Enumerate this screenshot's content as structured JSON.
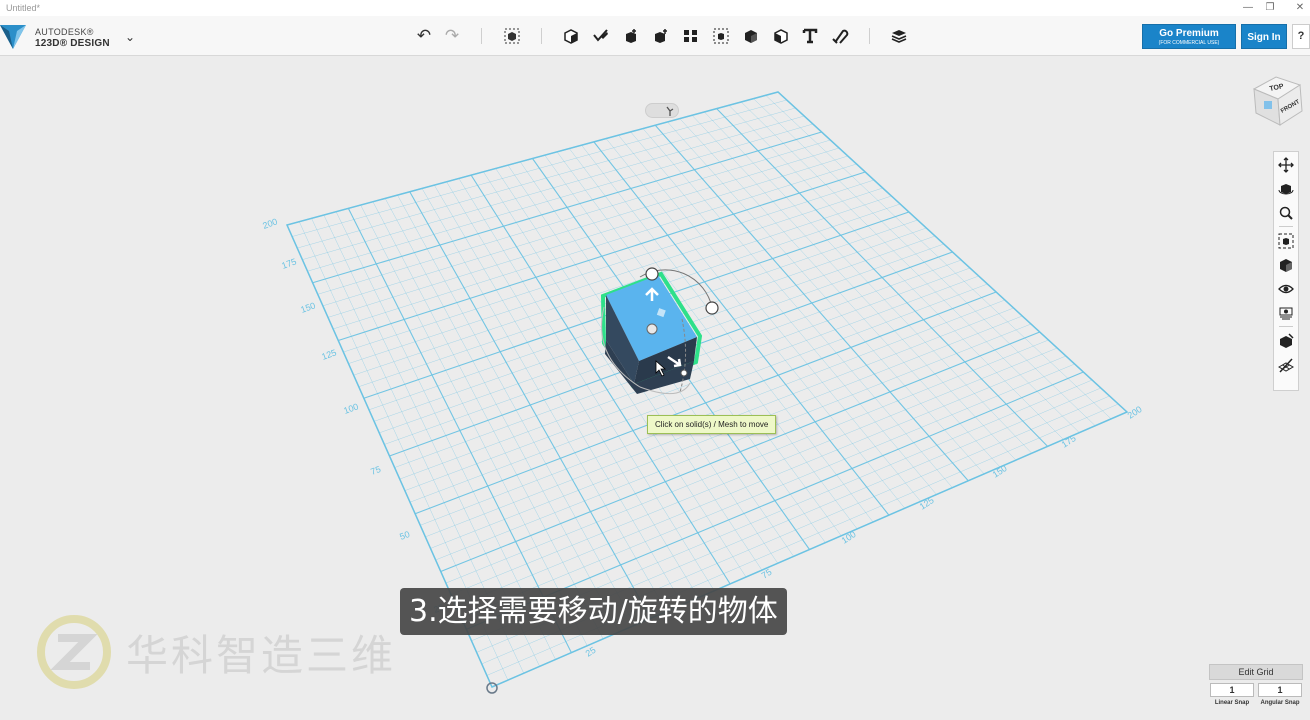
{
  "titlebar": {
    "title": "Untitled*",
    "minimize": "—",
    "restore": "❐",
    "close": "✕"
  },
  "brand": {
    "line1": "AUTODESK®",
    "line2": "123D® DESIGN",
    "menu_chevron": "⌄"
  },
  "toolbar": {
    "tools": [
      {
        "name": "undo",
        "glyph": "↶"
      },
      {
        "name": "redo",
        "glyph": "↷"
      },
      {
        "name": "transform"
      },
      {
        "name": "primitives"
      },
      {
        "name": "sketch"
      },
      {
        "name": "construct"
      },
      {
        "name": "modify"
      },
      {
        "name": "pattern"
      },
      {
        "name": "grouping"
      },
      {
        "name": "combine"
      },
      {
        "name": "measure"
      },
      {
        "name": "text"
      },
      {
        "name": "snap"
      },
      {
        "name": "materials"
      }
    ],
    "premium_label": "Go Premium",
    "premium_sub": "(FOR COMMERCIAL USE)",
    "signin_label": "Sign In",
    "help_label": "?"
  },
  "viewcube": {
    "top": "TOP",
    "front": "FRONT"
  },
  "grid": {
    "left_axis_ticks": [
      "200",
      "175",
      "150",
      "125",
      "100",
      "75",
      "50",
      "25"
    ],
    "bottom_axis_ticks": [
      "25",
      "75",
      "100",
      "125",
      "150",
      "175",
      "200"
    ]
  },
  "tooltip": {
    "text": "Click on solid(s) / Mesh to move"
  },
  "subtitle": {
    "text": "3.选择需要移动/旋转的物体"
  },
  "watermark": {
    "text": "华科智造三维"
  },
  "grid_editor": {
    "button_label": "Edit Grid",
    "linear_value": "1",
    "angular_value": "1",
    "linear_label": "Linear Snap",
    "angular_label": "Angular Snap"
  },
  "colors": {
    "accent": "#1a84c9",
    "grid_line": "#6cc3e3",
    "cube_top": "#5ab4ee",
    "cube_side": "#2e3f52",
    "selection": "#2ee08a"
  }
}
